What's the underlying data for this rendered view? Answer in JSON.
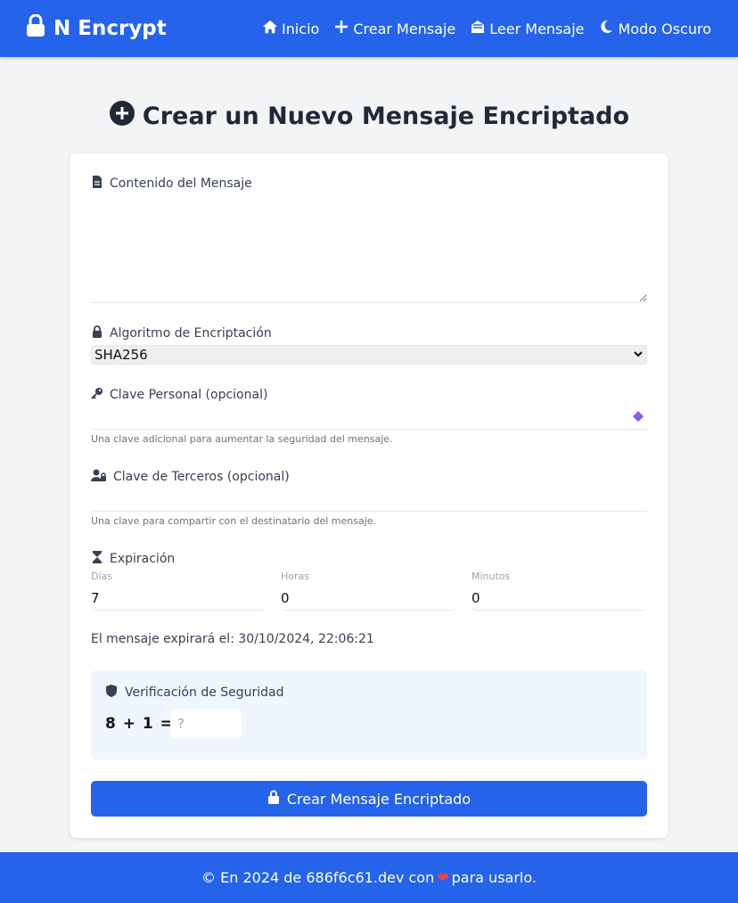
{
  "nav": {
    "brand": "N Encrypt",
    "links": [
      {
        "label": "Inicio",
        "icon": "home-icon"
      },
      {
        "label": "Crear Mensaje",
        "icon": "plus-icon"
      },
      {
        "label": "Leer Mensaje",
        "icon": "envelope-open-icon"
      },
      {
        "label": "Modo Oscuro",
        "icon": "moon-icon"
      }
    ]
  },
  "page": {
    "title": "Crear un Nuevo Mensaje Encriptado"
  },
  "form": {
    "content": {
      "label": "Contenido del Mensaje",
      "value": ""
    },
    "algorithm": {
      "label": "Algoritmo de Encriptación",
      "selected": "SHA256"
    },
    "personal_key": {
      "label": "Clave Personal (opcional)",
      "value": "",
      "hint": "Una clave adicional para aumentar la seguridad del mensaje."
    },
    "third_party_key": {
      "label": "Clave de Terceros (opcional)",
      "value": "",
      "hint": "Una clave para compartir con el destinatario del mensaje."
    },
    "expiration": {
      "label": "Expiración",
      "days_label": "Días",
      "days": "7",
      "hours_label": "Horas",
      "hours": "0",
      "minutes_label": "Minutos",
      "minutes": "0",
      "expires_text": "El mensaje expirará el: 30/10/2024, 22:06:21"
    },
    "verification": {
      "label": "Verificación de Seguridad",
      "equation": "8 + 1 =",
      "placeholder": "?"
    },
    "submit_label": "Crear Mensaje Encriptado"
  },
  "footer": {
    "prefix": "© En 2024 de 686f6c61.dev con",
    "heart": "❤",
    "suffix": "para usarlo."
  },
  "colors": {
    "primary": "#2563eb",
    "background": "#f3f4f6",
    "verify_bg": "#eff6ff"
  }
}
